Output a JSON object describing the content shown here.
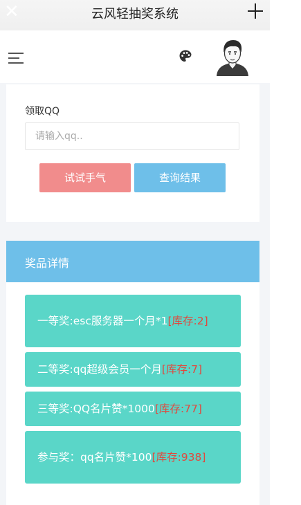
{
  "titlebar": {
    "title": "云风轻抽奖系统",
    "close_icon": "close-icon",
    "add_icon": "plus-icon"
  },
  "header": {
    "menu_icon": "hamburger-menu-icon",
    "theme_icon": "palette-icon",
    "avatar": "user-avatar"
  },
  "form": {
    "label": "领取QQ",
    "qq_placeholder": "请输入qq..",
    "qq_value": "",
    "try_button": "试试手气",
    "query_button": "查询结果"
  },
  "prizes": {
    "heading": "奖品详情",
    "items": [
      {
        "text": "一等奖:esc服务器一个月*1",
        "stock": "[库存:2]"
      },
      {
        "text": "二等奖:qq超级会员一个月",
        "stock": "[库存:7]"
      },
      {
        "text": "三等奖:QQ名片赞*1000",
        "stock": "[库存:77]"
      },
      {
        "text": "参与奖：qq名片赞*100",
        "stock": "[库存:938]"
      }
    ]
  },
  "colors": {
    "try_button": "#f18c8c",
    "query_button": "#6ebfe9",
    "prize_header": "#6ebfe9",
    "prize_item": "#5ad6c8",
    "stock_text": "#e0493e"
  }
}
